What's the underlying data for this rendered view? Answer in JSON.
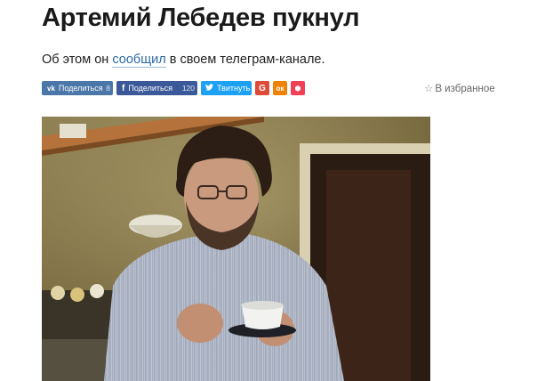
{
  "article": {
    "title": "Артемий Лебедев пукнул",
    "lead_before": "Об этом он ",
    "lead_link": "сообщил",
    "lead_after": " в своем телеграм-канале."
  },
  "share": {
    "vk": {
      "label": "Поделиться",
      "count": "8",
      "icon": "vk-icon"
    },
    "facebook": {
      "label": "Поделиться",
      "count": "120",
      "icon": "facebook-icon"
    },
    "twitter": {
      "label": "Твитнуть",
      "icon": "twitter-bird-icon"
    },
    "google": {
      "glyph": "G",
      "icon": "google-plus-icon"
    },
    "odnoklassniki": {
      "glyph": "ок",
      "icon": "odnoklassniki-icon"
    },
    "pocket": {
      "glyph": "⬢",
      "icon": "pocket-icon"
    }
  },
  "favorites": {
    "label": "В избранное",
    "icon": "star-icon"
  },
  "colors": {
    "vk": "#4a76a8",
    "facebook": "#3b5998",
    "twitter": "#1da1f2",
    "google": "#dd4b39",
    "odnoklassniki": "#ee8208",
    "pocket": "#ef4056",
    "link": "#2d6aa6"
  }
}
